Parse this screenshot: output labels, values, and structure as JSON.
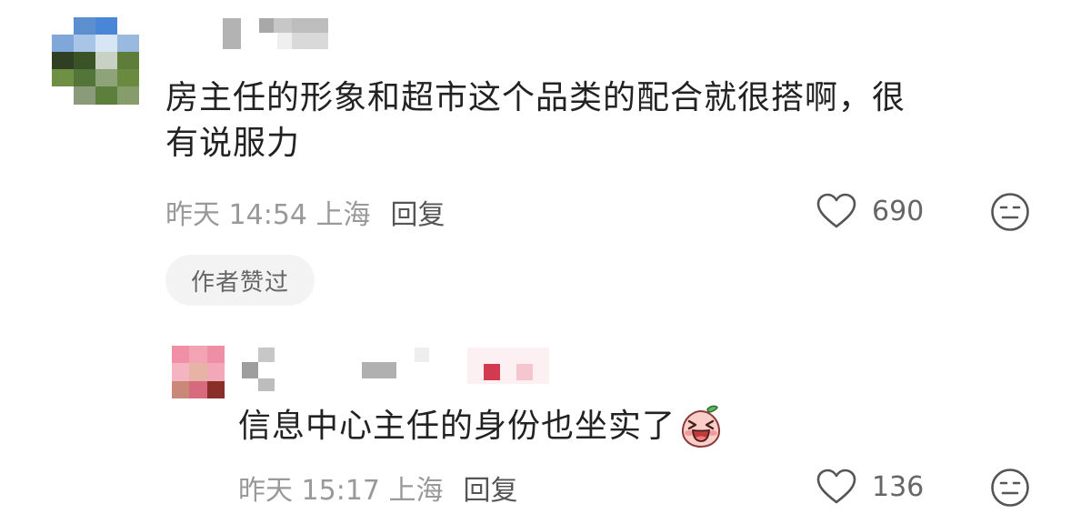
{
  "comments": [
    {
      "text": "房主任的形象和超市这个品类的配合就很搭啊，很有说服力",
      "line1": "房主任的形象和超市这个品类的配合就很搭啊，很",
      "line2": "有说服力",
      "time": "昨天 14:54 上海",
      "reply_label": "回复",
      "likes": "690",
      "badge": "作者赞过",
      "icons": [
        "heart-outline-icon",
        "neutral-face-icon"
      ]
    },
    {
      "text": "信息中心主任的身份也坐实了",
      "time": "昨天 15:17 上海",
      "reply_label": "回复",
      "likes": "136",
      "inline_emoji": "laughing-peach-emoji",
      "icons": [
        "heart-outline-icon",
        "neutral-face-icon"
      ]
    }
  ],
  "colors": {
    "text": "#222222",
    "meta": "#999999",
    "badge_bg": "#f3f3f3",
    "icon": "#555555"
  }
}
